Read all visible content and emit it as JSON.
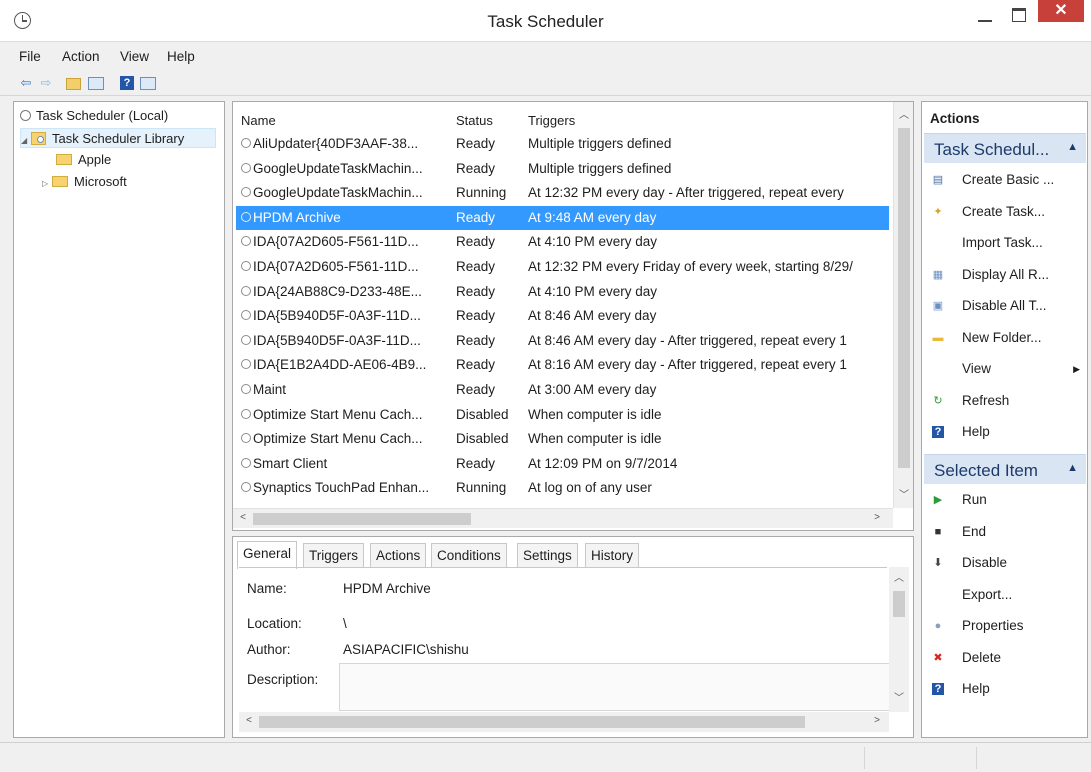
{
  "window": {
    "title": "Task Scheduler",
    "close_glyph": "✕"
  },
  "menu": [
    "File",
    "Action",
    "View",
    "Help"
  ],
  "toolbar": {
    "back_glyph": "⇦",
    "forward_glyph": "⇨",
    "help_glyph": "?"
  },
  "tree": {
    "root": "Task Scheduler (Local)",
    "library": "Task Scheduler Library",
    "children": [
      "Apple",
      "Microsoft"
    ]
  },
  "task_list": {
    "columns": [
      "Name",
      "Status",
      "Triggers"
    ],
    "selected_index": 3,
    "rows": [
      {
        "name": "AliUpdater{40DF3AAF-38...",
        "status": "Ready",
        "triggers": "Multiple triggers defined"
      },
      {
        "name": "GoogleUpdateTaskMachin...",
        "status": "Ready",
        "triggers": "Multiple triggers defined"
      },
      {
        "name": "GoogleUpdateTaskMachin...",
        "status": "Running",
        "triggers": "At 12:32 PM every day - After triggered, repeat every"
      },
      {
        "name": "HPDM Archive",
        "status": "Ready",
        "triggers": "At 9:48 AM every day"
      },
      {
        "name": "IDA{07A2D605-F561-11D...",
        "status": "Ready",
        "triggers": "At 4:10 PM every day"
      },
      {
        "name": "IDA{07A2D605-F561-11D...",
        "status": "Ready",
        "triggers": "At 12:32 PM every Friday of every week, starting 8/29/"
      },
      {
        "name": "IDA{24AB88C9-D233-48E...",
        "status": "Ready",
        "triggers": "At 4:10 PM every day"
      },
      {
        "name": "IDA{5B940D5F-0A3F-11D...",
        "status": "Ready",
        "triggers": "At 8:46 AM every day"
      },
      {
        "name": "IDA{5B940D5F-0A3F-11D...",
        "status": "Ready",
        "triggers": "At 8:46 AM every day - After triggered, repeat every 1"
      },
      {
        "name": "IDA{E1B2A4DD-AE06-4B9...",
        "status": "Ready",
        "triggers": "At 8:16 AM every day - After triggered, repeat every 1"
      },
      {
        "name": "Maint",
        "status": "Ready",
        "triggers": "At 3:00 AM every day"
      },
      {
        "name": "Optimize Start Menu Cach...",
        "status": "Disabled",
        "triggers": "When computer is idle"
      },
      {
        "name": "Optimize Start Menu Cach...",
        "status": "Disabled",
        "triggers": "When computer is idle"
      },
      {
        "name": "Smart Client",
        "status": "Ready",
        "triggers": "At 12:09 PM on 9/7/2014"
      },
      {
        "name": "Synaptics TouchPad Enhan...",
        "status": "Running",
        "triggers": "At log on of any user"
      }
    ]
  },
  "details": {
    "tabs": [
      "General",
      "Triggers",
      "Actions",
      "Conditions",
      "Settings",
      "History"
    ],
    "active_tab": "General",
    "fields": {
      "name_label": "Name:",
      "name_value": "HPDM Archive",
      "location_label": "Location:",
      "location_value": "\\",
      "author_label": "Author:",
      "author_value": "ASIAPACIFIC\\shishu",
      "description_label": "Description:"
    }
  },
  "actions_pane": {
    "title": "Actions",
    "section1": {
      "title": "Task Schedul...",
      "items": [
        {
          "label": "Create Basic ...",
          "icon": "wizard-icon"
        },
        {
          "label": "Create Task...",
          "icon": "create-task-icon"
        },
        {
          "label": "Import Task...",
          "icon": "none"
        },
        {
          "label": "Display All R...",
          "icon": "list-icon"
        },
        {
          "label": "Disable All T...",
          "icon": "disable-history-icon"
        },
        {
          "label": "New Folder...",
          "icon": "folder-icon"
        },
        {
          "label": "View",
          "icon": "none",
          "submenu": true
        },
        {
          "label": "Refresh",
          "icon": "refresh-icon"
        },
        {
          "label": "Help",
          "icon": "help-icon"
        }
      ]
    },
    "section2": {
      "title": "Selected Item",
      "items": [
        {
          "label": "Run",
          "icon": "run-icon"
        },
        {
          "label": "End",
          "icon": "end-icon"
        },
        {
          "label": "Disable",
          "icon": "disable-icon"
        },
        {
          "label": "Export...",
          "icon": "none"
        },
        {
          "label": "Properties",
          "icon": "properties-icon"
        },
        {
          "label": "Delete",
          "icon": "delete-icon"
        },
        {
          "label": "Help",
          "icon": "help-icon"
        }
      ]
    }
  },
  "colors": {
    "selection": "#3399ff",
    "section_header": "#d9e5f3",
    "close_button": "#c7413a"
  }
}
